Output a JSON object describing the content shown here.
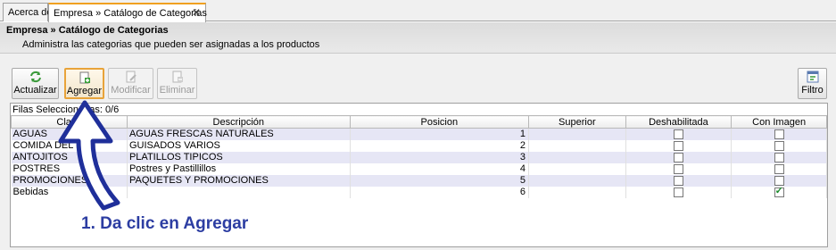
{
  "tabs": [
    {
      "label": "Acerca de"
    },
    {
      "label": "Empresa » Catálogo de Categorias",
      "close": "✕"
    }
  ],
  "header": {
    "title": "Empresa » Catálogo de Categorias",
    "subtitle": "Administra las categorias que pueden ser asignadas a los productos"
  },
  "toolbar": {
    "actualizar": "Actualizar",
    "agregar": "Agregar",
    "modificar": "Modificar",
    "eliminar": "Eliminar",
    "filtro": "Filtro"
  },
  "grid": {
    "status": "Filas Seleccionadas: 0/6",
    "columns": [
      "Clave",
      "Descripción",
      "Posicion",
      "Superior",
      "Deshabilitada",
      "Con Imagen"
    ],
    "rows": [
      {
        "nombre": "AGUAS",
        "descripcion": "AGUAS FRESCAS NATURALES",
        "posicion": "1",
        "superior": "",
        "deshabilitada": false,
        "con_imagen": false
      },
      {
        "nombre": "COMIDA DEL DIA",
        "descripcion": "GUISADOS VARIOS",
        "posicion": "2",
        "superior": "",
        "deshabilitada": false,
        "con_imagen": false
      },
      {
        "nombre": "ANTOJITOS",
        "descripcion": "PLATILLOS TIPICOS",
        "posicion": "3",
        "superior": "",
        "deshabilitada": false,
        "con_imagen": false
      },
      {
        "nombre": "POSTRES",
        "descripcion": "Postres y Pastillillos",
        "posicion": "4",
        "superior": "",
        "deshabilitada": false,
        "con_imagen": false
      },
      {
        "nombre": "PROMOCIONES",
        "descripcion": "PAQUETES Y PROMOCIONES",
        "posicion": "5",
        "superior": "",
        "deshabilitada": false,
        "con_imagen": false
      },
      {
        "nombre": "Bebidas",
        "descripcion": "",
        "posicion": "6",
        "superior": "",
        "deshabilitada": false,
        "con_imagen": true
      }
    ]
  },
  "annotation": {
    "text": "1. Da clic en Agregar",
    "color": "#2c3da2"
  },
  "colors": {
    "focus_border": "#e8a33a",
    "alt_row": "#e6e6f5",
    "check_green": "#1a8a2a"
  }
}
